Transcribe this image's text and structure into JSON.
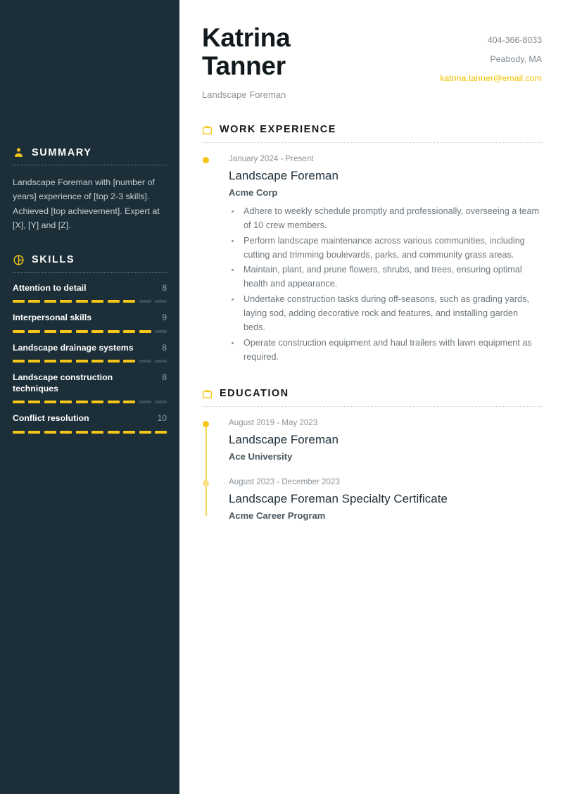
{
  "header": {
    "first_name": "Katrina",
    "last_name": "Tanner",
    "role": "Landscape Foreman",
    "phone": "404-366-8033",
    "location": "Peabody, MA",
    "email": "katrina.tanner@email.com"
  },
  "colors": {
    "sidebar_bg": "#1c2f38",
    "accent": "#f5c518",
    "accent_soft": "#fadf7f",
    "heading": "#12191d",
    "body_text": "#6d777d"
  },
  "sidebar": {
    "summary": {
      "icon": "user-icon",
      "title": "SUMMARY",
      "text": "Landscape Foreman with [number of years] experience of [top 2-3 skills]. Achieved [top achievement]. Expert at [X], [Y] and [Z]."
    },
    "skills": {
      "icon": "chart-pie-icon",
      "title": "SKILLS",
      "max": 10,
      "items": [
        {
          "name": "Attention to detail",
          "score": 8
        },
        {
          "name": "Interpersonal skills",
          "score": 9
        },
        {
          "name": "Landscape drainage systems",
          "score": 8
        },
        {
          "name": "Landscape construction techniques",
          "score": 8
        },
        {
          "name": "Conflict resolution",
          "score": 10
        }
      ]
    }
  },
  "main": {
    "work": {
      "icon": "briefcase-icon",
      "title": "WORK EXPERIENCE",
      "entries": [
        {
          "date": "January 2024 - Present",
          "title": "Landscape Foreman",
          "org": "Acme Corp",
          "bullets": [
            "Adhere to weekly schedule promptly and professionally, overseeing a team of 10 crew members.",
            "Perform landscape maintenance across various communities, including cutting and trimming boulevards, parks, and community grass areas.",
            "Maintain, plant, and prune flowers, shrubs, and trees, ensuring optimal health and appearance.",
            "Undertake construction tasks during off-seasons, such as grading yards, laying sod, adding decorative rock and features, and installing garden beds.",
            "Operate construction equipment and haul trailers with lawn equipment as required."
          ]
        }
      ]
    },
    "education": {
      "icon": "briefcase-icon",
      "title": "EDUCATION",
      "entries": [
        {
          "date": "August 2019 - May 2023",
          "title": "Landscape Foreman",
          "org": "Ace University"
        },
        {
          "date": "August 2023 - December 2023",
          "title": "Landscape Foreman Specialty Certificate",
          "org": "Acme Career Program"
        }
      ]
    }
  }
}
